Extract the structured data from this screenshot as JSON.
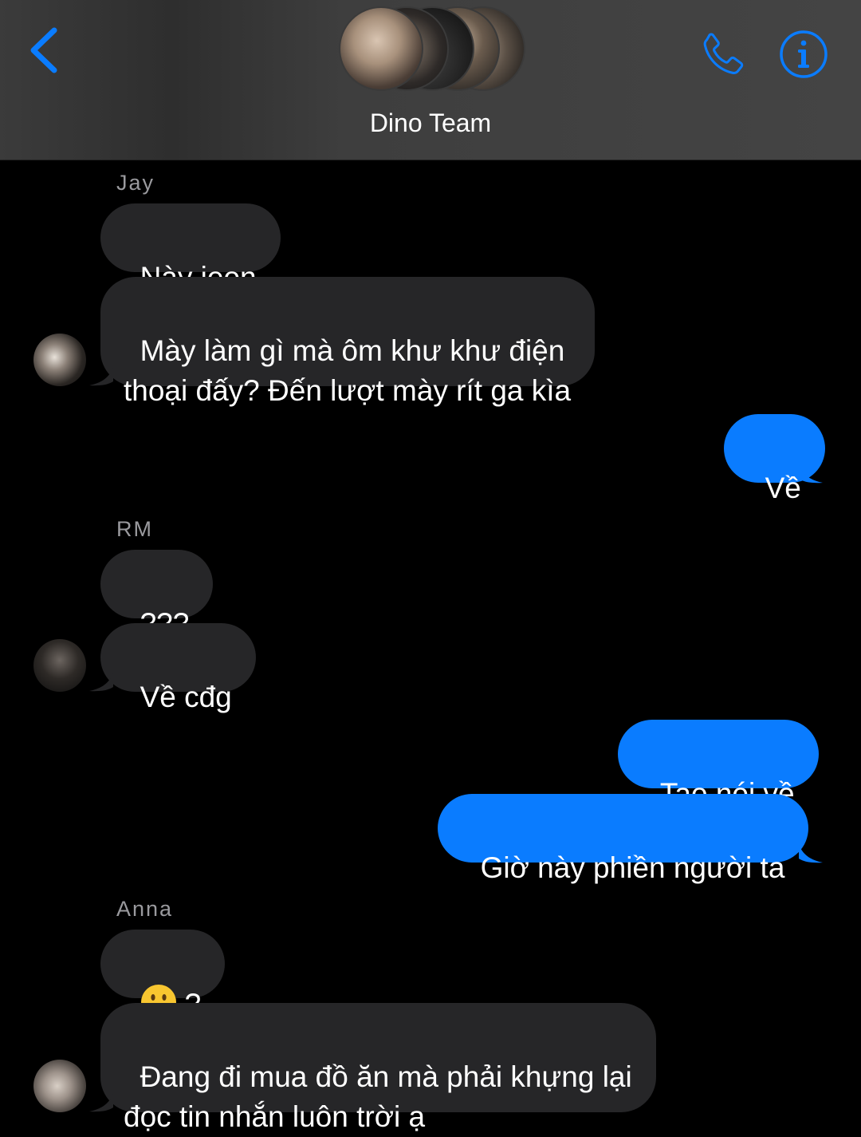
{
  "header": {
    "group_name": "Dino Team",
    "back_icon": "chevron-left-icon",
    "call_icon": "phone-icon",
    "info_icon": "info-icon",
    "accent_color": "#0a7cff"
  },
  "messages": [
    {
      "sender": "Jay",
      "direction": "incoming",
      "texts": [
        "Này jeon",
        "Mày làm gì mà ôm khư khư điện\nthoại đấy? Đến lượt mày rít ga kìa"
      ]
    },
    {
      "sender": "",
      "direction": "outgoing",
      "texts": [
        "Về"
      ]
    },
    {
      "sender": "RM",
      "direction": "incoming",
      "texts": [
        "???",
        "Về cđg"
      ]
    },
    {
      "sender": "",
      "direction": "outgoing",
      "texts": [
        "Tao nói về",
        "Giờ này phiền người ta"
      ]
    },
    {
      "sender": "Anna",
      "direction": "incoming",
      "texts": [
        "?",
        "Đang đi mua đồ ăn mà phải khựng lại\nđọc tin nhắn luôn trời ạ"
      ],
      "emoji": "grinning-face-emoji"
    }
  ],
  "colors": {
    "incoming_bubble": "#262628",
    "outgoing_bubble": "#0a7cff",
    "sender_label": "#9a9a9e"
  }
}
